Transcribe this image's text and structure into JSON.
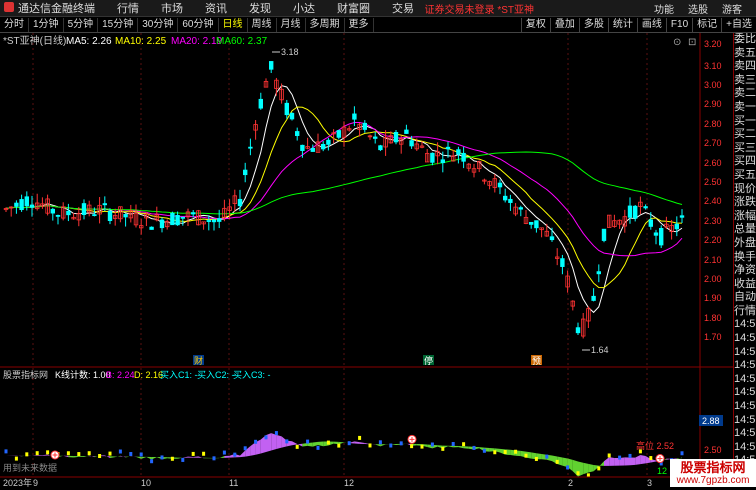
{
  "app": {
    "logo": "通达信金融终端"
  },
  "menu": [
    "行情",
    "市场",
    "资讯",
    "发现",
    "小达",
    "财富圈",
    "交易"
  ],
  "notice": "证券交易未登录 *ST亚神",
  "menu_right": [
    "功能",
    "选股",
    "游客"
  ],
  "period_tabs": [
    "分时",
    "1分钟",
    "5分钟",
    "15分钟",
    "30分钟",
    "60分钟",
    "日线",
    "周线",
    "月线",
    "多周期",
    "更多"
  ],
  "active_tab": "日线",
  "toolbar_right": [
    "复权",
    "叠加",
    "多股",
    "统计",
    "画线",
    "F10",
    "标记",
    "+自选"
  ],
  "main_legend": {
    "title": "*ST亚神(日线)",
    "ma5": "MA5: 2.26",
    "ma10": "MA10: 2.25",
    "ma20": "MA20: 2.19",
    "ma60": "MA60: 2.37"
  },
  "price_labels": [
    "3.20",
    "3.10",
    "3.00",
    "2.90",
    "2.80",
    "2.70",
    "2.60",
    "2.50",
    "2.40",
    "2.30",
    "2.20",
    "2.10",
    "2.00",
    "1.90",
    "1.80",
    "1.70"
  ],
  "annotations": {
    "high": "3.18",
    "low": "1.64"
  },
  "event_markers": [
    "财",
    "停",
    "预"
  ],
  "sub_legend": {
    "title": "股票指标网",
    "k_count": "K线计数: 1.00",
    "b": "B: 2.24",
    "d": "D: 2.16",
    "c1": "买入C1: -",
    "c2": "买入C2: -",
    "c3": "买入C3: -"
  },
  "sub_price_labels": [
    "2.88",
    "2.50"
  ],
  "sub_annotation": "高位 2.52",
  "sub_small": "12",
  "sub_status": "用到未来数据",
  "date_labels": [
    "2023年",
    "9",
    "10",
    "11",
    "12",
    "2",
    "3"
  ],
  "right_panel": [
    "委比",
    "卖五",
    "卖四",
    "卖三",
    "卖二",
    "卖一",
    "买一",
    "买二",
    "买三",
    "买四",
    "买五",
    "现价",
    "涨跌",
    "涨幅",
    "总量",
    "外盘",
    "换手",
    "净资",
    "收益",
    "自动",
    "行情",
    "14:5",
    "14:5",
    "14:5",
    "14:5",
    "14:5",
    "14:5",
    "14:5",
    "14:5",
    "14:5",
    "14:5",
    "14:5",
    "14:5"
  ],
  "watermark": {
    "line1": "股票指标网",
    "line2": "www.7gpzb.com"
  },
  "colors": {
    "up": "#ff3333",
    "down": "#00ffff",
    "ma5": "#ffffff",
    "ma10": "#ffff00",
    "ma20": "#ff00ff",
    "ma60": "#00ff00"
  }
}
